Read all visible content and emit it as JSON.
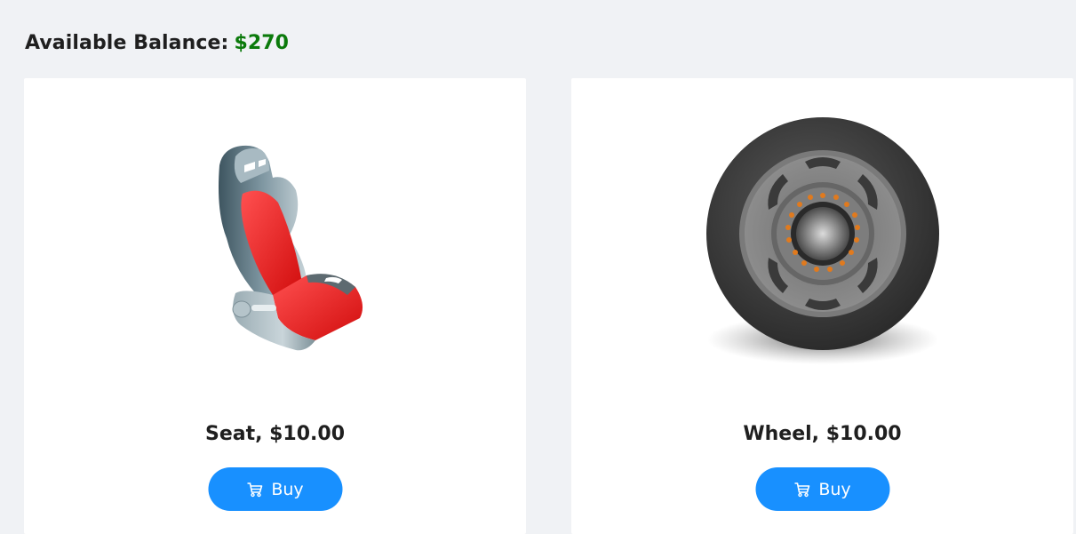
{
  "balance": {
    "label": "Available Balance:",
    "value": "$270"
  },
  "products": [
    {
      "name": "Seat, $10.00",
      "button_label": "Buy",
      "icon": "car-seat-image"
    },
    {
      "name": "Wheel, $10.00",
      "button_label": "Buy",
      "icon": "wheel-image"
    }
  ],
  "colors": {
    "accent": "#1890ff",
    "balance": "#0b7a0b",
    "background": "#f0f2f5"
  }
}
